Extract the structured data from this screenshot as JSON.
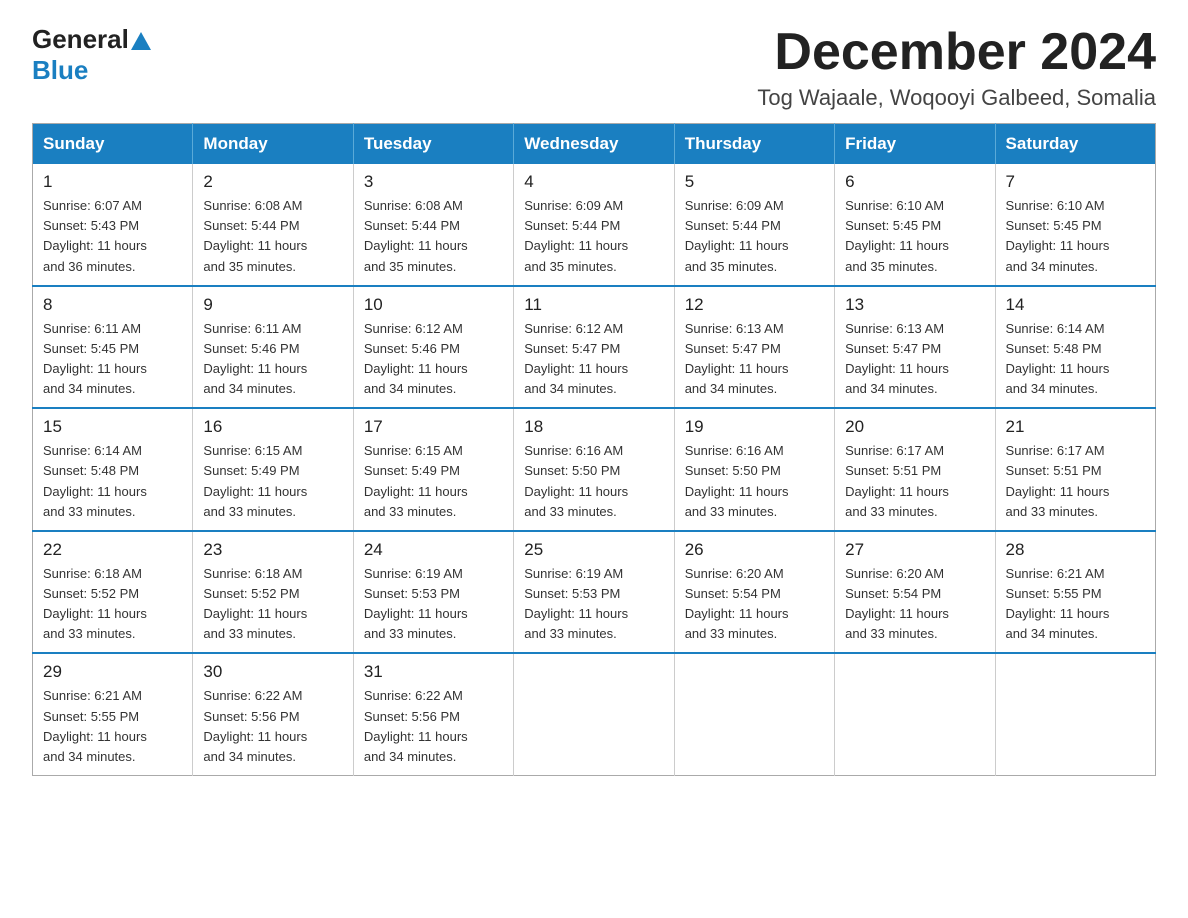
{
  "logo": {
    "general": "General",
    "blue": "Blue"
  },
  "header": {
    "month": "December 2024",
    "location": "Tog Wajaale, Woqooyi Galbeed, Somalia"
  },
  "weekdays": [
    "Sunday",
    "Monday",
    "Tuesday",
    "Wednesday",
    "Thursday",
    "Friday",
    "Saturday"
  ],
  "weeks": [
    [
      {
        "day": "1",
        "sunrise": "6:07 AM",
        "sunset": "5:43 PM",
        "daylight": "11 hours and 36 minutes."
      },
      {
        "day": "2",
        "sunrise": "6:08 AM",
        "sunset": "5:44 PM",
        "daylight": "11 hours and 35 minutes."
      },
      {
        "day": "3",
        "sunrise": "6:08 AM",
        "sunset": "5:44 PM",
        "daylight": "11 hours and 35 minutes."
      },
      {
        "day": "4",
        "sunrise": "6:09 AM",
        "sunset": "5:44 PM",
        "daylight": "11 hours and 35 minutes."
      },
      {
        "day": "5",
        "sunrise": "6:09 AM",
        "sunset": "5:44 PM",
        "daylight": "11 hours and 35 minutes."
      },
      {
        "day": "6",
        "sunrise": "6:10 AM",
        "sunset": "5:45 PM",
        "daylight": "11 hours and 35 minutes."
      },
      {
        "day": "7",
        "sunrise": "6:10 AM",
        "sunset": "5:45 PM",
        "daylight": "11 hours and 34 minutes."
      }
    ],
    [
      {
        "day": "8",
        "sunrise": "6:11 AM",
        "sunset": "5:45 PM",
        "daylight": "11 hours and 34 minutes."
      },
      {
        "day": "9",
        "sunrise": "6:11 AM",
        "sunset": "5:46 PM",
        "daylight": "11 hours and 34 minutes."
      },
      {
        "day": "10",
        "sunrise": "6:12 AM",
        "sunset": "5:46 PM",
        "daylight": "11 hours and 34 minutes."
      },
      {
        "day": "11",
        "sunrise": "6:12 AM",
        "sunset": "5:47 PM",
        "daylight": "11 hours and 34 minutes."
      },
      {
        "day": "12",
        "sunrise": "6:13 AM",
        "sunset": "5:47 PM",
        "daylight": "11 hours and 34 minutes."
      },
      {
        "day": "13",
        "sunrise": "6:13 AM",
        "sunset": "5:47 PM",
        "daylight": "11 hours and 34 minutes."
      },
      {
        "day": "14",
        "sunrise": "6:14 AM",
        "sunset": "5:48 PM",
        "daylight": "11 hours and 34 minutes."
      }
    ],
    [
      {
        "day": "15",
        "sunrise": "6:14 AM",
        "sunset": "5:48 PM",
        "daylight": "11 hours and 33 minutes."
      },
      {
        "day": "16",
        "sunrise": "6:15 AM",
        "sunset": "5:49 PM",
        "daylight": "11 hours and 33 minutes."
      },
      {
        "day": "17",
        "sunrise": "6:15 AM",
        "sunset": "5:49 PM",
        "daylight": "11 hours and 33 minutes."
      },
      {
        "day": "18",
        "sunrise": "6:16 AM",
        "sunset": "5:50 PM",
        "daylight": "11 hours and 33 minutes."
      },
      {
        "day": "19",
        "sunrise": "6:16 AM",
        "sunset": "5:50 PM",
        "daylight": "11 hours and 33 minutes."
      },
      {
        "day": "20",
        "sunrise": "6:17 AM",
        "sunset": "5:51 PM",
        "daylight": "11 hours and 33 minutes."
      },
      {
        "day": "21",
        "sunrise": "6:17 AM",
        "sunset": "5:51 PM",
        "daylight": "11 hours and 33 minutes."
      }
    ],
    [
      {
        "day": "22",
        "sunrise": "6:18 AM",
        "sunset": "5:52 PM",
        "daylight": "11 hours and 33 minutes."
      },
      {
        "day": "23",
        "sunrise": "6:18 AM",
        "sunset": "5:52 PM",
        "daylight": "11 hours and 33 minutes."
      },
      {
        "day": "24",
        "sunrise": "6:19 AM",
        "sunset": "5:53 PM",
        "daylight": "11 hours and 33 minutes."
      },
      {
        "day": "25",
        "sunrise": "6:19 AM",
        "sunset": "5:53 PM",
        "daylight": "11 hours and 33 minutes."
      },
      {
        "day": "26",
        "sunrise": "6:20 AM",
        "sunset": "5:54 PM",
        "daylight": "11 hours and 33 minutes."
      },
      {
        "day": "27",
        "sunrise": "6:20 AM",
        "sunset": "5:54 PM",
        "daylight": "11 hours and 33 minutes."
      },
      {
        "day": "28",
        "sunrise": "6:21 AM",
        "sunset": "5:55 PM",
        "daylight": "11 hours and 34 minutes."
      }
    ],
    [
      {
        "day": "29",
        "sunrise": "6:21 AM",
        "sunset": "5:55 PM",
        "daylight": "11 hours and 34 minutes."
      },
      {
        "day": "30",
        "sunrise": "6:22 AM",
        "sunset": "5:56 PM",
        "daylight": "11 hours and 34 minutes."
      },
      {
        "day": "31",
        "sunrise": "6:22 AM",
        "sunset": "5:56 PM",
        "daylight": "11 hours and 34 minutes."
      },
      null,
      null,
      null,
      null
    ]
  ]
}
